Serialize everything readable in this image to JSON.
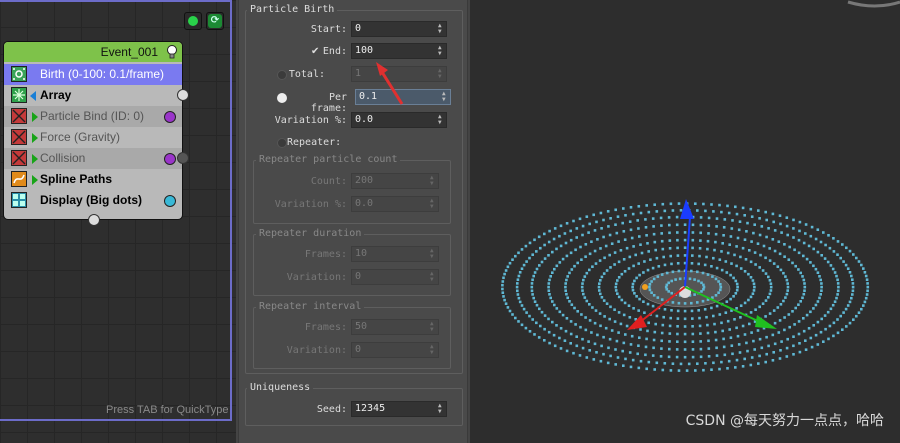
{
  "particle_view": {
    "quicktype_hint": "Press TAB for QuickType",
    "event": {
      "title": "Event_001",
      "operators": [
        {
          "label": "Birth (0-100: 0.1/frame)",
          "state": "selected",
          "icon": "birth-icon"
        },
        {
          "label": "Array",
          "state": "active",
          "icon": "array-icon"
        },
        {
          "label": "Particle Bind (ID: 0)",
          "state": "disabled",
          "icon": "particle-bind-icon"
        },
        {
          "label": "Force (Gravity)",
          "state": "disabled",
          "icon": "force-icon"
        },
        {
          "label": "Collision",
          "state": "disabled",
          "icon": "collision-icon"
        },
        {
          "label": "Spline Paths",
          "state": "active",
          "icon": "spline-paths-icon"
        },
        {
          "label": "Display (Big dots)",
          "state": "active",
          "icon": "display-icon"
        }
      ]
    }
  },
  "rollout": {
    "birth_group": {
      "title": "Particle Birth",
      "start": {
        "label": "Start:",
        "value": "0"
      },
      "end": {
        "label": "End:",
        "value": "100",
        "checked": true
      },
      "total": {
        "label": "Total:",
        "value": "1"
      },
      "per_frame": {
        "label": "Per frame:",
        "value": "0.1",
        "selected": true
      },
      "variation": {
        "label": "Variation %:",
        "value": "0.0"
      },
      "repeater": {
        "label": "Repeater:"
      }
    },
    "repeater_count": {
      "title": "Repeater particle count",
      "count": {
        "label": "Count:",
        "value": "200"
      },
      "variation": {
        "label": "Variation %:",
        "value": "0.0"
      }
    },
    "repeater_duration": {
      "title": "Repeater duration",
      "frames": {
        "label": "Frames:",
        "value": "10"
      },
      "variation": {
        "label": "Variation:",
        "value": "0"
      }
    },
    "repeater_interval": {
      "title": "Repeater interval",
      "frames": {
        "label": "Frames:",
        "value": "50"
      },
      "variation": {
        "label": "Variation:",
        "value": "0"
      }
    },
    "uniqueness": {
      "title": "Uniqueness",
      "seed": {
        "label": "Seed:",
        "value": "12345"
      }
    }
  },
  "viewport": {
    "watermark": "CSDN @每天努力一点点，哈哈",
    "particle_color": "#5fb8d4"
  },
  "colors": {
    "event_header": "#7ec24a",
    "selected_operator": "#7a7af0",
    "annotation_arrow": "#e03030"
  }
}
